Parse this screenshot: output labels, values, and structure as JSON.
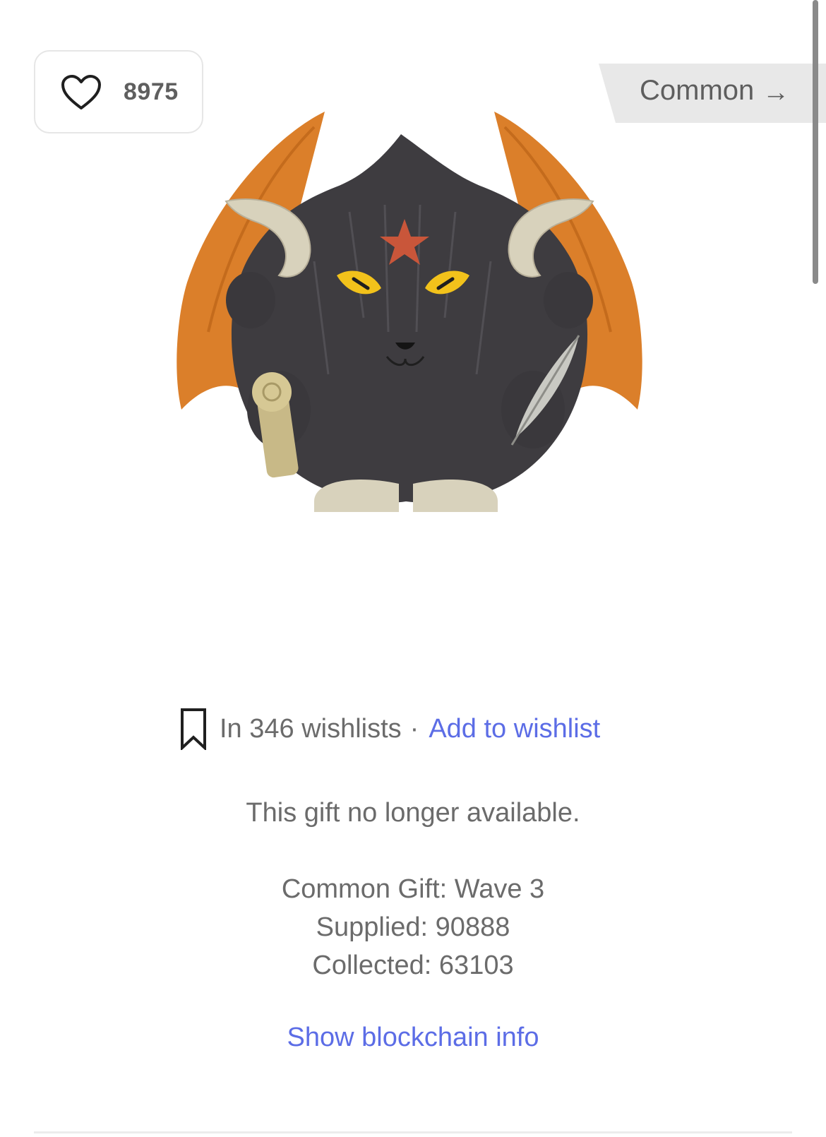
{
  "like": {
    "count": "8975",
    "icon": "heart-icon"
  },
  "rarity": {
    "label": "Common",
    "arrow": "→",
    "bg_color": "#e8e8e8"
  },
  "gift": {
    "image_icon": "gift-character-image"
  },
  "wishlist": {
    "icon": "bookmark-icon",
    "count_text": "In 346 wishlists",
    "separator": "·",
    "add_label": "Add to wishlist"
  },
  "availability_text": "This gift no longer available.",
  "details": {
    "collection": "Common Gift: Wave 3",
    "supplied": "Supplied: 90888",
    "collected": "Collected: 63103"
  },
  "blockchain_label": "Show blockchain info",
  "colors": {
    "link": "#5c6de6",
    "text": "#6b6b6b",
    "wing": "#d9781f",
    "fur": "#3e3c40",
    "horn": "#d8d2bc",
    "eye": "#f2c21b",
    "star": "#c9563a"
  }
}
